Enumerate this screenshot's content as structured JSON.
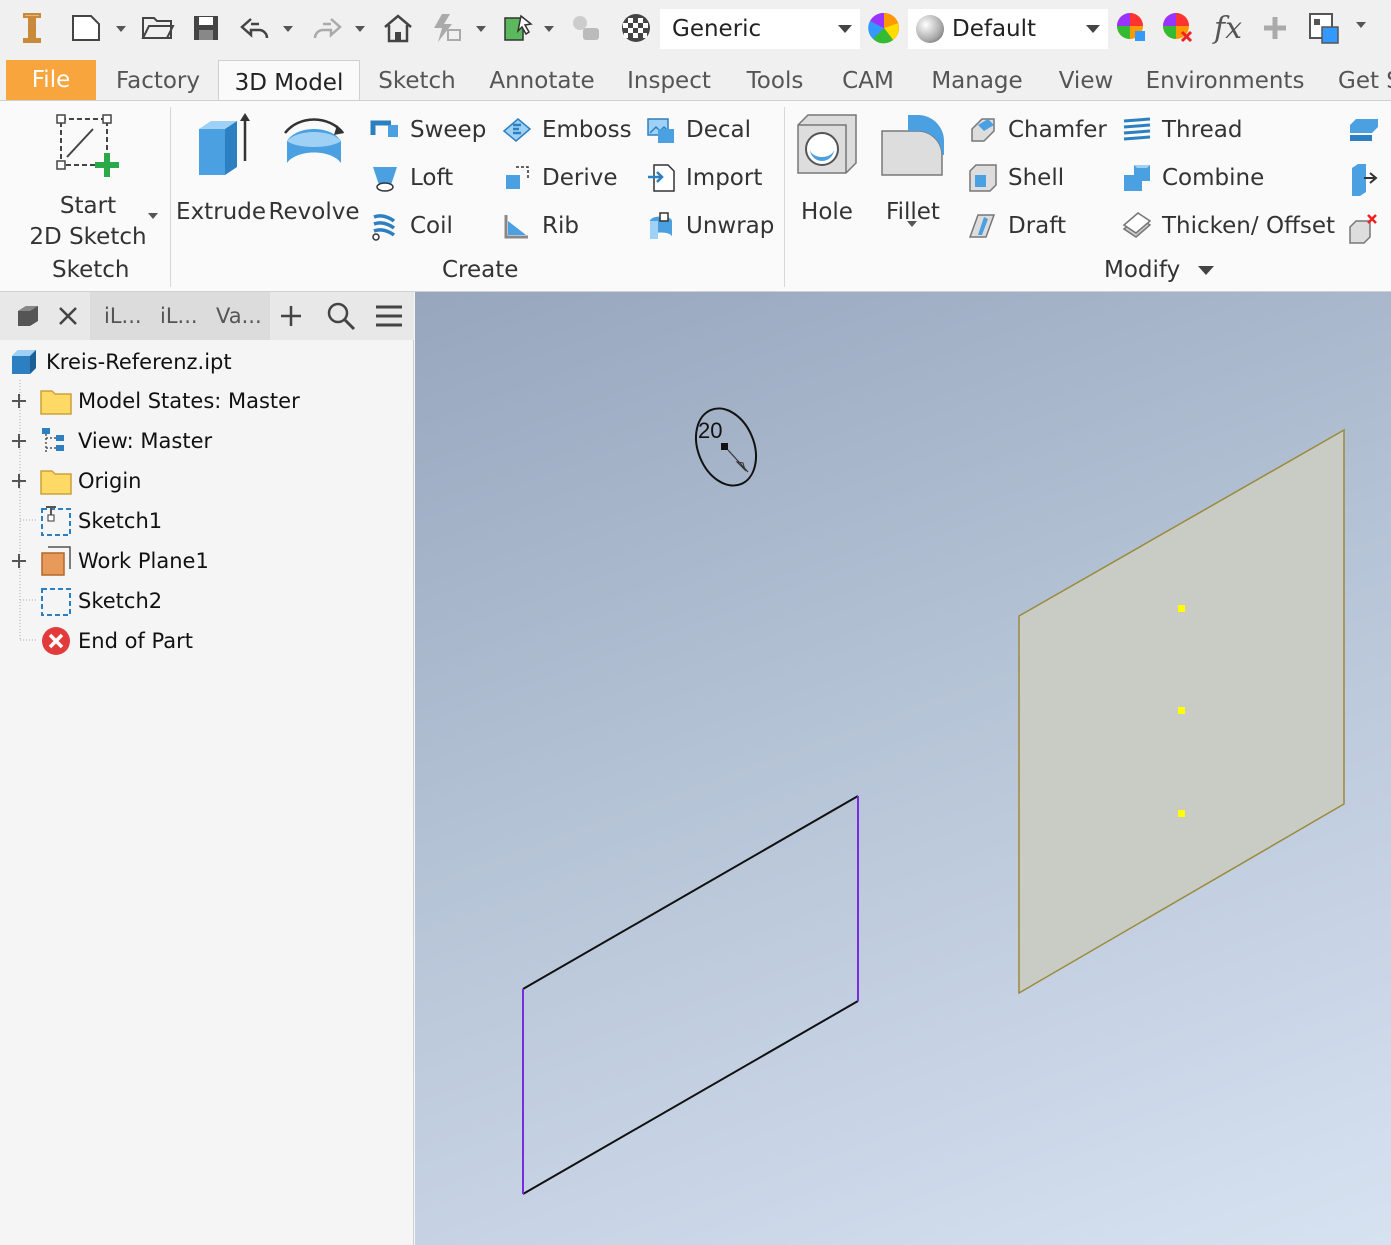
{
  "qat": {
    "material": "Generic",
    "appearance": "Default"
  },
  "tabs": [
    "File",
    "Factory",
    "3D Model",
    "Sketch",
    "Annotate",
    "Inspect",
    "Tools",
    "CAM",
    "Manage",
    "View",
    "Environments",
    "Get S"
  ],
  "ribbon": {
    "sketch_group": {
      "start_line1": "Start",
      "start_line2": "2D Sketch",
      "label": "Sketch"
    },
    "create_group": {
      "extrude": "Extrude",
      "revolve": "Revolve",
      "sweep": "Sweep",
      "loft": "Loft",
      "coil": "Coil",
      "emboss": "Emboss",
      "derive": "Derive",
      "rib": "Rib",
      "decal": "Decal",
      "import": "Import",
      "unwrap": "Unwrap",
      "label": "Create"
    },
    "modify_group": {
      "hole": "Hole",
      "fillet": "Fillet",
      "chamfer": "Chamfer",
      "shell": "Shell",
      "draft": "Draft",
      "thread": "Thread",
      "combine": "Combine",
      "thicken": "Thicken/ Offset",
      "label": "Modify"
    }
  },
  "browser": {
    "tabs": [
      "iL...",
      "iL...",
      "Va..."
    ],
    "root": "Kreis-Referenz.ipt",
    "items": [
      {
        "label": "Model States: Master"
      },
      {
        "label": "View: Master"
      },
      {
        "label": "Origin"
      },
      {
        "label": "Sketch1"
      },
      {
        "label": "Work Plane1"
      },
      {
        "label": "Sketch2"
      },
      {
        "label": "End of Part"
      }
    ]
  },
  "viewport": {
    "dimension_value": "20"
  },
  "colors": {
    "file_tab": "#f7a53c",
    "workplane_fill": "#c9ccc4",
    "workplane_edge": "#9a8a3a",
    "sketch_line": "#111111",
    "sketch_edge_highlight": "#7a2be0",
    "point_marker": "#ffff00"
  }
}
